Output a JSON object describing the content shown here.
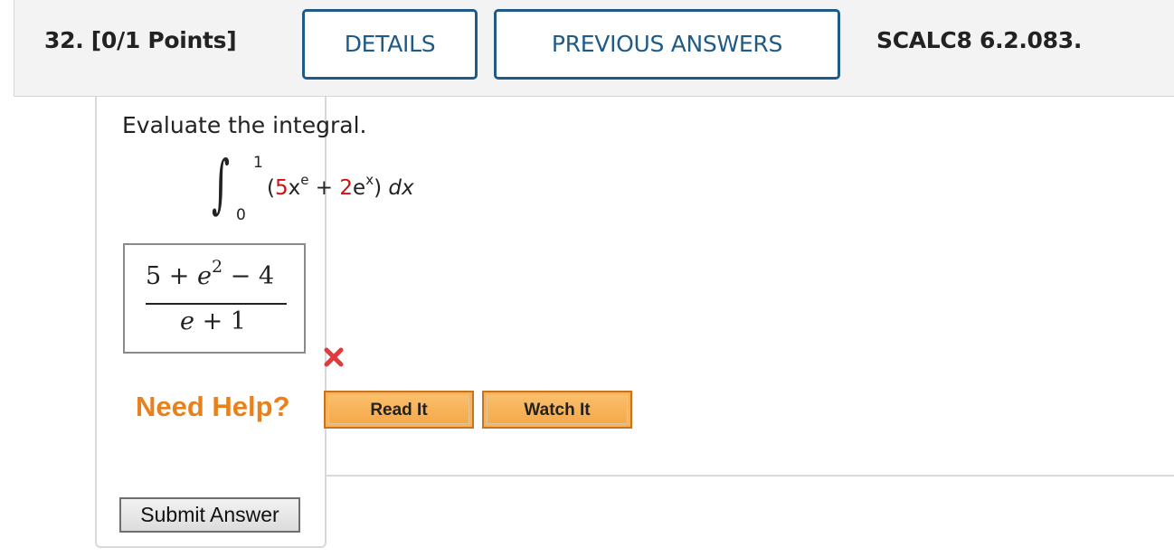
{
  "header": {
    "question_label": "32. [0/1 Points]",
    "details_button": "DETAILS",
    "previous_answers_button": "PREVIOUS ANSWERS",
    "source_label": "SCALC8 6.2.083."
  },
  "question": {
    "prompt": "Evaluate the integral.",
    "integral": {
      "upper_limit": "1",
      "lower_limit": "0",
      "open_paren": "(",
      "coef1": "5",
      "var1": "x",
      "exp1": "e",
      "plus": " + ",
      "coef2": "2",
      "base2": "e",
      "exp2": "x",
      "close_paren": ")",
      "differential": " dx"
    }
  },
  "answer": {
    "numerator_a": "5 + ",
    "numerator_e": "e",
    "numerator_exp": "2",
    "numerator_b": " − 4",
    "denominator_e": "e",
    "denominator_b": " + 1",
    "status": "incorrect",
    "status_color": "#e0393e"
  },
  "help": {
    "label": "Need Help?",
    "read_it": "Read It",
    "watch_it": "Watch It"
  },
  "submit_label": "Submit Answer",
  "colors": {
    "accent_blue": "#1f5b86",
    "help_orange": "#e8811b",
    "coefficient_red": "#cc1111"
  }
}
